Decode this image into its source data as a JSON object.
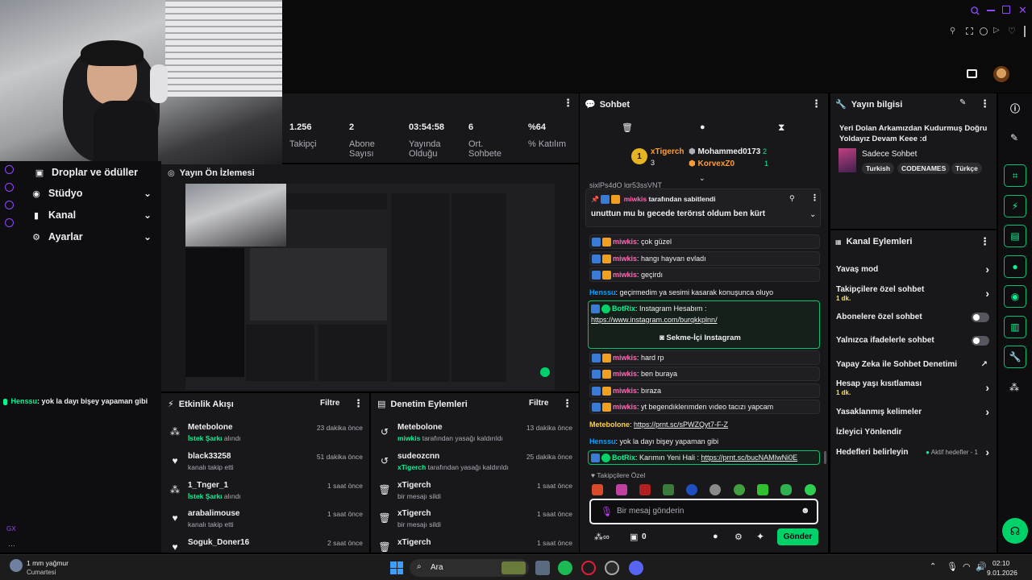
{
  "stats": [
    {
      "value": "1.256",
      "label": "Takipçi"
    },
    {
      "value": "2",
      "label": "Abone Sayısı"
    },
    {
      "value": "03:54:58",
      "label": "Yayında Olduğu"
    },
    {
      "value": "6",
      "label": "Ort. Sohbete"
    },
    {
      "value": "%64",
      "label": "% Katılım"
    }
  ],
  "nav": {
    "drops": "Droplar ve ödüller",
    "studio": "Stüdyo",
    "channel": "Kanal",
    "settings": "Ayarlar"
  },
  "left_chat_msg": {
    "user": "Henssu",
    "text": ": yok la dayı bişey yapaman gibi"
  },
  "preview_title": "Yayın Ön İzlemesi",
  "activity": {
    "title": "Etkinlik Akışı",
    "filter": "Filtre",
    "items": [
      {
        "name": "Metebolone",
        "sub_hl": "İstek Şarkı",
        "sub": " alındı",
        "time": "23 dakika önce"
      },
      {
        "name": "black33258",
        "sub_hl": "",
        "sub": "kanalı takip etti",
        "time": "51 dakika önce"
      },
      {
        "name": "1_Tnger_1",
        "sub_hl": "İstek Şarkı",
        "sub": " alındı",
        "time": "1 saat önce"
      },
      {
        "name": "arabalimouse",
        "sub_hl": "",
        "sub": "kanalı takip etti",
        "time": "1 saat önce"
      },
      {
        "name": "Soguk_Doner16",
        "sub_hl": "",
        "sub": "",
        "time": "2 saat önce"
      }
    ]
  },
  "moderation": {
    "title": "Denetim Eylemleri",
    "filter": "Filtre",
    "items": [
      {
        "name": "Metebolone",
        "sub_hl": "miwkis",
        "sub": " tarafından yasağı kaldırıldı",
        "time": "13 dakika önce"
      },
      {
        "name": "sudeozcnn",
        "sub_hl": "xTigerch",
        "sub": " tarafından yasağı kaldırıldı",
        "time": "25 dakika önce"
      },
      {
        "name": "xTigerch",
        "sub_hl": "",
        "sub": "bir mesajı sildi",
        "time": "1 saat önce"
      },
      {
        "name": "xTigerch",
        "sub_hl": "",
        "sub": "bir mesajı sildi",
        "time": "1 saat önce"
      },
      {
        "name": "xTigerch",
        "sub_hl": "",
        "sub": "",
        "time": "1 saat önce"
      }
    ]
  },
  "chat": {
    "title": "Sohbet",
    "leader": {
      "name": "xTigerch",
      "count": "3",
      "rank": "1"
    },
    "others": [
      {
        "name": "Mohammed0173",
        "count": "2"
      },
      {
        "name": "KorvexZ0",
        "count": "1"
      }
    ],
    "truncated": "sixlPs4dO lqr53ssVNT",
    "pinned": {
      "by": "miwkis",
      "by_suffix": " tarafından sabitlendi",
      "text": "unuttun mu bı gecede terörıst oldum ben kürt"
    },
    "messages": [
      {
        "user": "miwkis",
        "text": ": çok güzel"
      },
      {
        "user": "miwkis",
        "text": ": hangı hayvan evladı"
      },
      {
        "user": "miwkis",
        "text": ": geçirdı"
      }
    ],
    "henssu1": {
      "user": "Henssu",
      "text": ": geçirmedim ya sesimi kasarak konuşunca oluyo"
    },
    "botrix1": {
      "user": "BotRix",
      "text": ": Instagram Hesabım :",
      "link": "https://www.instagram.com/burqkkplnn/",
      "button": "Sekme-İçi Instagram"
    },
    "messages2": [
      {
        "user": "miwkis",
        "text": ": hard rp"
      },
      {
        "user": "miwkis",
        "text": ": ben buraya"
      },
      {
        "user": "miwkis",
        "text": ": bıraza"
      },
      {
        "user": "miwkis",
        "text": ": yt begendıklerımden vıdeo tacızı yapcam"
      }
    ],
    "mete": {
      "user": "Metebolone",
      "text": ": ",
      "link": "https://prnt.sc/sPWZQyt7-F-Z"
    },
    "henssu2": {
      "user": "Henssu",
      "text": ": yok la dayı bişey yapaman gibi"
    },
    "botrix2": {
      "user": "BotRix",
      "text": ": Karımın Yeni Hali : ",
      "link": "https://prnt.sc/bucNAMIwNi0E"
    },
    "emote_label": "Takipçilere Özel",
    "placeholder": "Bir mesaj gönderin",
    "points": "0",
    "send": "Gönder"
  },
  "stream_info": {
    "title": "Yayın bilgisi",
    "stream_title": "Yeri Dolan Arkamızdan Kudurmuş Doğru Yoldayız Devam Keee :d",
    "category": "Sadece Sohbet",
    "tags": [
      "Turkish",
      "CODENAMES",
      "Türkçe"
    ]
  },
  "channel_actions": {
    "title": "Kanal Eylemleri",
    "items": [
      {
        "label": "Yavaş mod",
        "sub": "",
        "ctrl": "chev"
      },
      {
        "label": "Takipçilere özel sohbet",
        "sub": "1 dk.",
        "ctrl": "chev"
      },
      {
        "label": "Abonelere özel sohbet",
        "sub": "",
        "ctrl": "toggle"
      },
      {
        "label": "Yalnızca ifadelerle sohbet",
        "sub": "",
        "ctrl": "toggle"
      },
      {
        "label": "Yapay Zeka ile Sohbet Denetimi",
        "sub": "",
        "ctrl": "ext"
      },
      {
        "label": "Hesap yaşı kısıtlaması",
        "sub": "1 dk.",
        "ctrl": "chev"
      },
      {
        "label": "Yasaklanmış kelimeler",
        "sub": "",
        "ctrl": "chev"
      },
      {
        "label": "İzleyici Yönlendir",
        "sub": "",
        "ctrl": ""
      },
      {
        "label": "Hedefleri belirleyin",
        "sub": "",
        "ctrl": "chev"
      }
    ],
    "goals_status": "Aktif hedefler - 1"
  },
  "taskbar": {
    "weather": "1 mm yağmur",
    "weather_day": "Cumartesi",
    "search": "Ara",
    "time": "02:10",
    "date": "9.01.2026"
  },
  "colors": {
    "accent": "#00f593",
    "purple": "#9147ff",
    "panel": "#18181b",
    "pink": "#ff69b4"
  }
}
